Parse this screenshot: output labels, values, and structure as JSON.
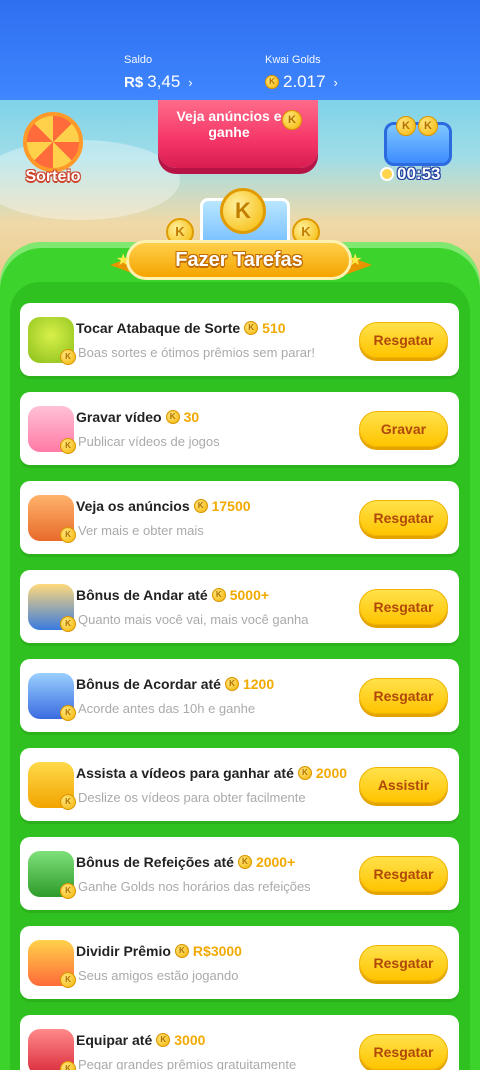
{
  "header": {
    "saldo_label": "Saldo",
    "saldo_currency": "R$",
    "saldo_value": "3,45",
    "golds_label": "Kwai Golds",
    "golds_value": "2.017",
    "chevron": "›"
  },
  "hero": {
    "sorteio_label": "Sorteio",
    "ad_button_label": "Veja anúncios e ganhe",
    "timer": "00:53"
  },
  "section_title": "Fazer Tarefas",
  "coin_letter": "K",
  "tasks": [
    {
      "title": "Tocar Atabaque de Sorte",
      "reward": "510",
      "subtitle": "Boas sortes e ótimos prêmios sem parar!",
      "button": "Resgatar",
      "icon": "drum-icon"
    },
    {
      "title": "Gravar vídeo",
      "reward": "30",
      "subtitle": "Publicar vídeos de jogos",
      "button": "Gravar",
      "icon": "record-icon"
    },
    {
      "title": "Veja os anúncios",
      "reward": "17500",
      "subtitle": "Ver mais e obter mais",
      "button": "Resgatar",
      "icon": "tv-icon"
    },
    {
      "title": "Bônus de Andar até",
      "reward": "5000+",
      "subtitle": "Quanto mais você vai, mais você ganha",
      "button": "Resgatar",
      "icon": "walking-icon"
    },
    {
      "title": "Bônus de Acordar até",
      "reward": "1200",
      "subtitle": "Acorde antes das 10h e ganhe",
      "button": "Resgatar",
      "icon": "moon-icon"
    },
    {
      "title": "Assista a vídeos para ganhar até",
      "reward": "2000",
      "subtitle": "Deslize os vídeos para obter facilmente",
      "button": "Assistir",
      "icon": "camera-icon"
    },
    {
      "title": "Bônus de Refeições até",
      "reward": "2000+",
      "subtitle": "Ganhe Golds nos horários das refeições",
      "button": "Resgatar",
      "icon": "calendar-icon"
    },
    {
      "title": "Dividir Prêmio",
      "reward": "R$3000",
      "subtitle": "Seus amigos estão jogando",
      "button": "Resgatar",
      "icon": "gift-icon"
    },
    {
      "title": "Equipar até",
      "reward": "3000",
      "subtitle": "Pegar grandes prêmios gratuitamente",
      "button": "Resgatar",
      "icon": "boxing-glove-icon"
    }
  ]
}
